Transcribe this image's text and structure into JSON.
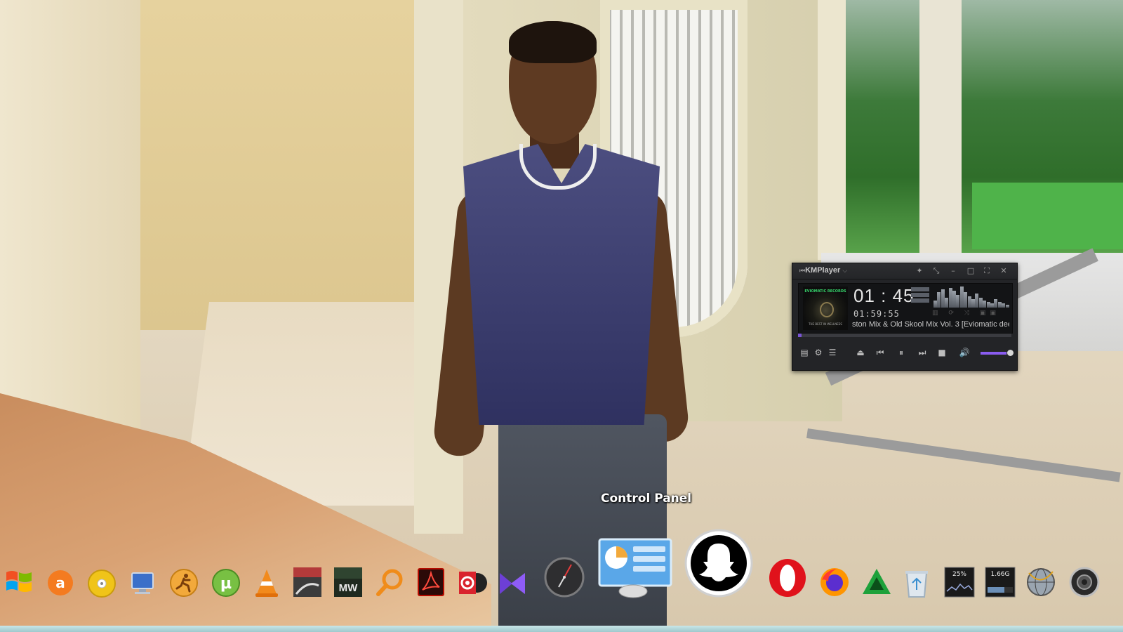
{
  "desktop": {
    "wallpaper": "photo of a man in a sleeveless navy top standing in a tiled corridor"
  },
  "kmplayer": {
    "logo": "KMPlayer",
    "logo_chevron": "⌵",
    "titlebar_icons": [
      "pin-icon",
      "mini-mode-icon",
      "minimize-icon",
      "maximize-icon",
      "fullscreen-icon",
      "close-icon"
    ],
    "album_art_label": "EVIOMATIC RECORDS",
    "album_art_sub": "THE BEST IN WELLNESS",
    "current_time": "01 : 45",
    "total_time": "01:59:55",
    "track_title": "ston Mix  & Old Skool Mix Vol. 3 [Eviomatic dee",
    "progress": 0.015,
    "volume": 0.85,
    "accent": "#7a55d6"
  },
  "dock": {
    "tooltip": "Control Panel",
    "items": [
      {
        "name": "windows-start-icon"
      },
      {
        "name": "avast-icon"
      },
      {
        "name": "dvd-icon"
      },
      {
        "name": "computer-icon"
      },
      {
        "name": "runner-app-icon"
      },
      {
        "name": "utorrent-icon"
      },
      {
        "name": "vlc-icon"
      },
      {
        "name": "racing-game-icon"
      },
      {
        "name": "nfs-most-wanted-icon",
        "label": "MW"
      },
      {
        "name": "search-icon"
      },
      {
        "name": "acrobat-reader-icon"
      },
      {
        "name": "music-player-icon"
      },
      {
        "name": "media-player-icon"
      },
      {
        "name": "clock-icon"
      },
      {
        "name": "control-panel-icon"
      },
      {
        "name": "snapchat-icon"
      },
      {
        "name": "opera-icon"
      },
      {
        "name": "firefox-icon"
      },
      {
        "name": "green-triangle-app-icon"
      },
      {
        "name": "recycle-bin-icon"
      },
      {
        "name": "cpu-meter-icon",
        "label": "25%"
      },
      {
        "name": "memory-meter-icon",
        "label": "1.66G"
      },
      {
        "name": "network-globe-icon"
      },
      {
        "name": "speaker-icon"
      }
    ]
  }
}
